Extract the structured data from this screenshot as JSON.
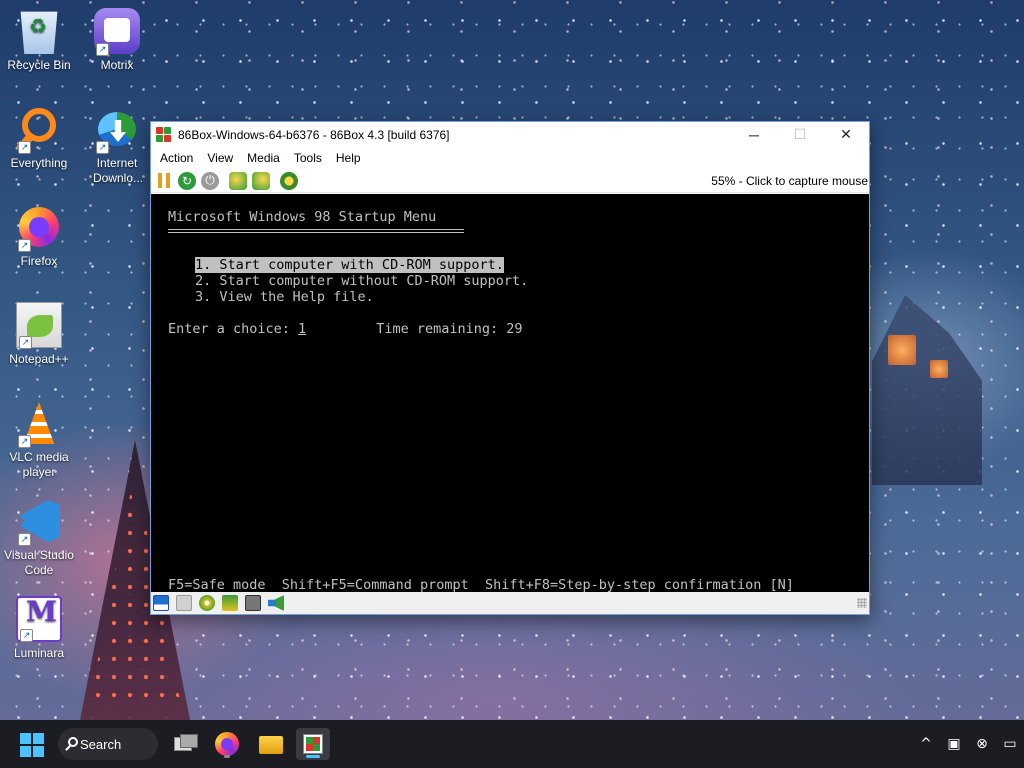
{
  "desktop": {
    "icons": [
      {
        "label": "Recycle Bin",
        "icon": "recycle-bin-icon"
      },
      {
        "label": "Motrix",
        "icon": "motrix-icon"
      },
      {
        "label": "Everything",
        "icon": "everything-icon"
      },
      {
        "label": "Internet Downlo...",
        "icon": "internet-download-manager-icon"
      },
      {
        "label": "Firefox",
        "icon": "firefox-icon"
      },
      {
        "label": "Notepad++",
        "icon": "notepad-plus-plus-icon"
      },
      {
        "label": "VLC media player",
        "icon": "vlc-icon"
      },
      {
        "label": "Visual Studio Code",
        "icon": "vscode-icon"
      },
      {
        "label": "Luminara",
        "icon": "luminara-icon"
      }
    ]
  },
  "window": {
    "title": "86Box-Windows-64-b6376 - 86Box 4.3 [build 6376]",
    "menu": [
      "Action",
      "View",
      "Media",
      "Tools",
      "Help"
    ],
    "capture_hint": "55% - Click to capture mouse",
    "controls": {
      "minimize": "─",
      "maximize": "☐",
      "close": "✕"
    }
  },
  "dos": {
    "title": "Microsoft Windows 98 Startup Menu",
    "options": [
      "1. Start computer with CD-ROM support.",
      "2. Start computer without CD-ROM support.",
      "3. View the Help file."
    ],
    "prompt_label": "Enter a choice: ",
    "choice": "1",
    "time_label": "Time remaining: ",
    "time_remaining": "29",
    "footer": "F5=Safe mode  Shift+F5=Command prompt  Shift+F8=Step-by-step confirmation [N]"
  },
  "taskbar": {
    "search_label": "Search",
    "tray": [
      "^",
      "▣",
      "⊗",
      "▭"
    ]
  },
  "colors": {
    "dos_text": "#c0c0c0",
    "dos_bg": "#000000",
    "taskbar_bg": "#1c1d22",
    "accent": "#4cc2ff"
  }
}
